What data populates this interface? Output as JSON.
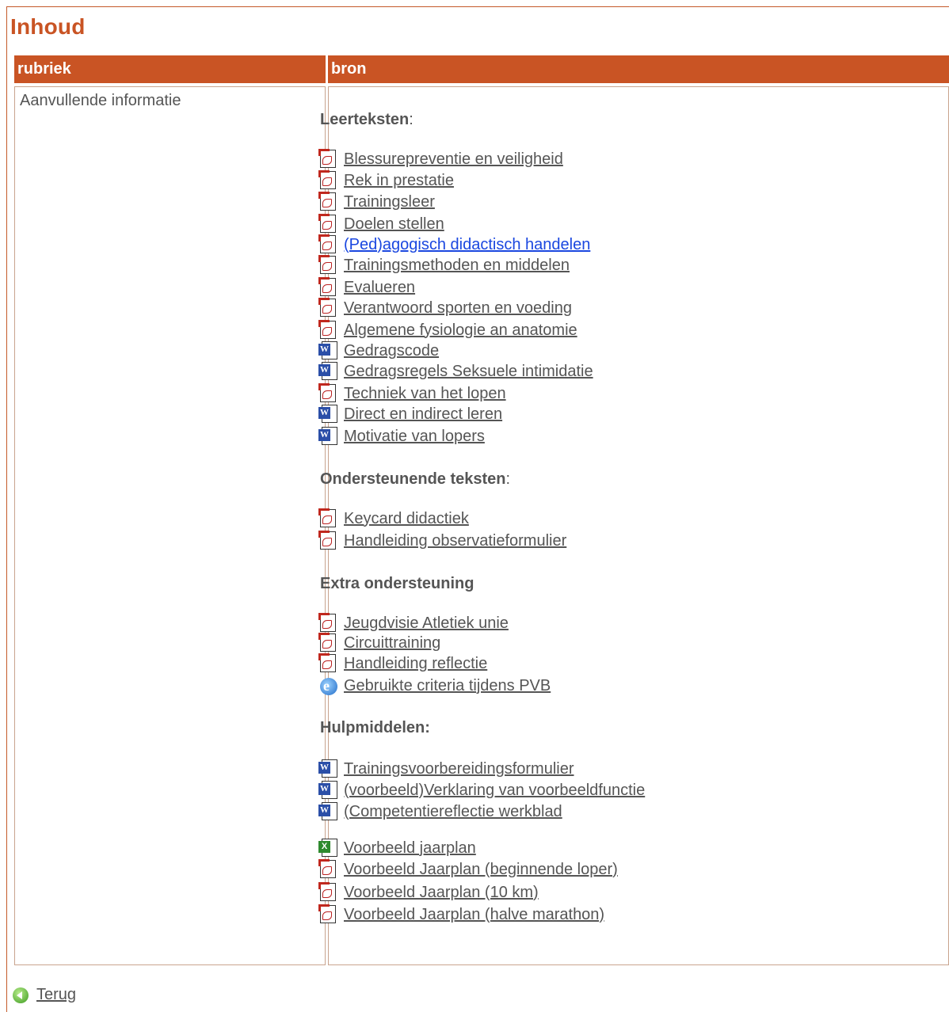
{
  "page_title": "Inhoud",
  "table": {
    "col_rubriek": "rubriek",
    "col_bron": "bron",
    "rubriek_value": "Aanvullende informatie"
  },
  "sections": [
    {
      "title": "Leerteksten",
      "colon": ":",
      "items": [
        {
          "label": "Blessurepreventie en veiligheid",
          "icon": "pdf-icon"
        },
        {
          "label": "Rek in prestatie",
          "icon": "pdf-icon"
        },
        {
          "label": "Trainingsleer",
          "icon": "pdf-icon"
        },
        {
          "label": "Doelen stellen",
          "icon": "pdf-icon"
        },
        {
          "label": "(Ped)agogisch didactisch handelen",
          "icon": "pdf-icon",
          "active": true
        },
        {
          "label": "Trainingsmethoden en middelen",
          "icon": "pdf-icon"
        },
        {
          "label": "Evalueren",
          "icon": "pdf-icon"
        },
        {
          "label": "Verantwoord sporten en voeding",
          "icon": "pdf-icon"
        },
        {
          "label": "Algemene fysiologie an anatomie",
          "icon": "pdf-icon"
        },
        {
          "label": "Gedragscode",
          "icon": "word-icon"
        },
        {
          "label": "Gedragsregels Seksuele intimidatie",
          "icon": "word-icon"
        },
        {
          "label": "Techniek van het lopen",
          "icon": "pdf-icon"
        },
        {
          "label": "Direct en indirect leren",
          "icon": "word-icon"
        },
        {
          "label": "Motivatie van lopers",
          "icon": "word-icon"
        }
      ]
    },
    {
      "title": "Ondersteunende teksten",
      "colon": ":",
      "items": [
        {
          "label": "Keycard didactiek",
          "icon": "pdf-icon"
        },
        {
          "label": "Handleiding observatieformulier",
          "icon": "pdf-icon"
        }
      ]
    },
    {
      "title": "Extra ondersteuning",
      "colon": "",
      "items": [
        {
          "label": "Jeugdvisie Atletiek unie",
          "icon": "pdf-icon"
        },
        {
          "label": "Circuittraining",
          "icon": "pdf-icon"
        },
        {
          "label": "Handleiding reflectie",
          "icon": "pdf-icon"
        },
        {
          "label": "Gebruikte criteria tijdens PVB",
          "icon": "ie-icon"
        }
      ]
    },
    {
      "title": "Hulpmiddelen:",
      "colon": "",
      "items": [
        {
          "label": "Trainingsvoorbereidingsformulier",
          "icon": "word-icon"
        },
        {
          "label": "(voorbeeld)Verklaring van voorbeeldfunctie",
          "icon": "word-icon"
        },
        {
          "label": "(Competentiereflectie werkblad",
          "icon": "word-icon"
        },
        {
          "label": "Voorbeeld jaarplan",
          "icon": "excel-icon"
        },
        {
          "label": "Voorbeeld Jaarplan (beginnende loper)",
          "icon": "pdf-icon"
        },
        {
          "label": "Voorbeeld Jaarplan (10 km)",
          "icon": "pdf-icon"
        },
        {
          "label": "Voorbeeld Jaarplan (halve marathon)",
          "icon": "pdf-icon"
        }
      ]
    }
  ],
  "back_label": "Terug"
}
